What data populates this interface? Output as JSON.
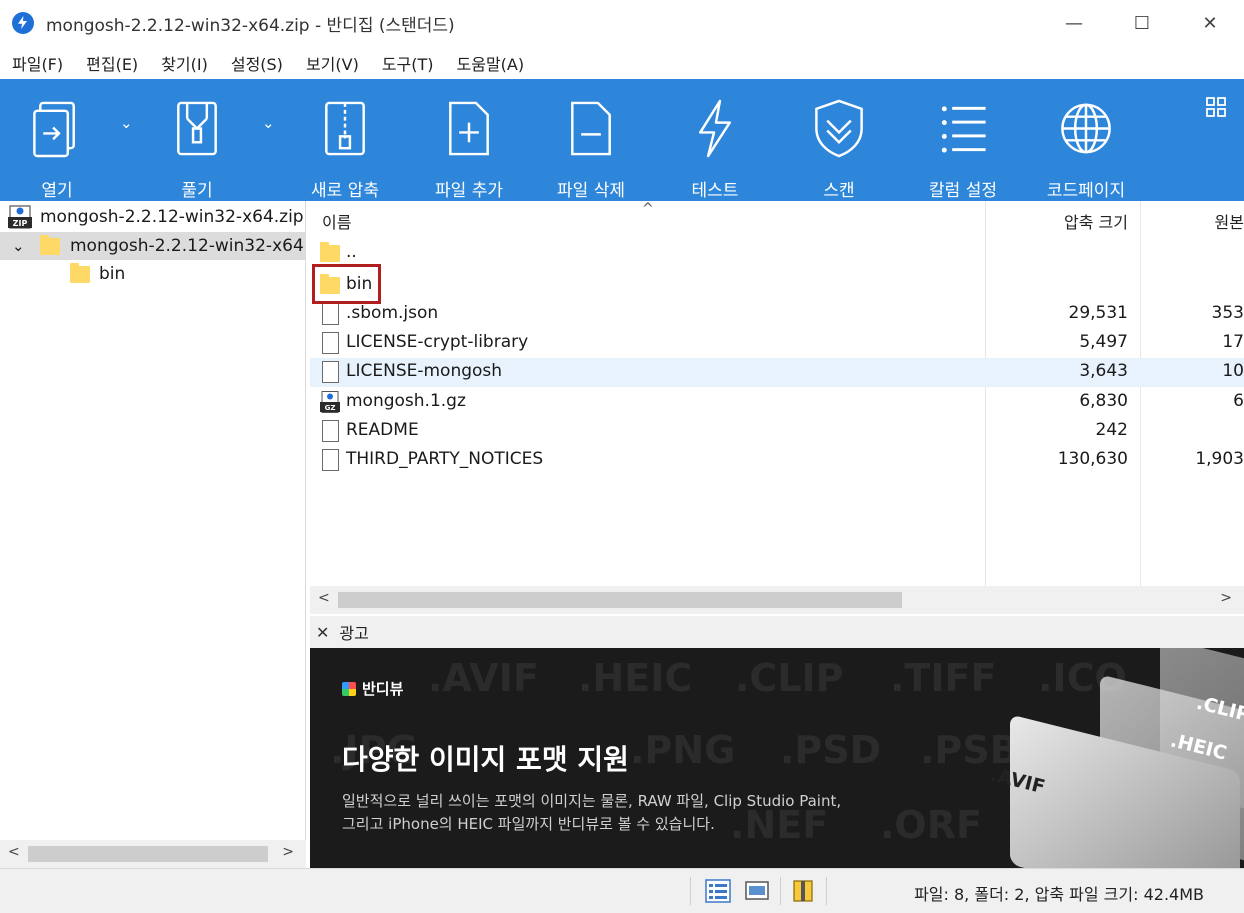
{
  "window": {
    "title": "mongosh-2.2.12-win32-x64.zip - 반디집 (스탠더드)",
    "min": "—",
    "max": "☐",
    "close": "✕"
  },
  "menu": [
    "파일(F)",
    "편집(E)",
    "찾기(I)",
    "설정(S)",
    "보기(V)",
    "도구(T)",
    "도움말(A)"
  ],
  "toolbar": {
    "open": "열기",
    "extract": "풀기",
    "new_archive": "새로 압축",
    "add_files": "파일 추가",
    "delete_files": "파일 삭제",
    "test": "테스트",
    "scan": "스캔",
    "column_settings": "칼럼 설정",
    "codepage": "코드페이지"
  },
  "tree": {
    "root": "mongosh-2.2.12-win32-x64.zip",
    "folder": "mongosh-2.2.12-win32-x64",
    "child": "bin",
    "expand_glyph": "⌄"
  },
  "columns": {
    "name": "이름",
    "compressed": "압축 크기",
    "original": "원본"
  },
  "files": [
    {
      "name": "..",
      "type": "folder",
      "compressed": "",
      "original": ""
    },
    {
      "name": "bin",
      "type": "folder",
      "compressed": "",
      "original": ""
    },
    {
      "name": ".sbom.json",
      "type": "file",
      "compressed": "29,531",
      "original": "353"
    },
    {
      "name": "LICENSE-crypt-library",
      "type": "file",
      "compressed": "5,497",
      "original": "17"
    },
    {
      "name": "LICENSE-mongosh",
      "type": "file",
      "compressed": "3,643",
      "original": "10"
    },
    {
      "name": "mongosh.1.gz",
      "type": "gz",
      "compressed": "6,830",
      "original": "6"
    },
    {
      "name": "README",
      "type": "file",
      "compressed": "242",
      "original": ""
    },
    {
      "name": "THIRD_PARTY_NOTICES",
      "type": "file",
      "compressed": "130,630",
      "original": "1,903"
    }
  ],
  "ad": {
    "close": "✕",
    "label": "광고",
    "brand": "반디뷰",
    "headline": "다양한 이미지 포맷 지원",
    "desc_line1": "일반적으로 널리 쓰이는 포맷의 이미지는 물론, RAW 파일, Clip Studio Paint,",
    "desc_line2": "그리고 iPhone의 HEIC 파일까지 반디뷰로 볼 수 있습니다.",
    "bg_words": [
      ".AVIF",
      ".HEIC",
      ".CLIP",
      ".TIFF",
      ".ICO",
      ".JPG",
      ".PNG",
      ".PSD",
      ".PSB",
      ".NEF",
      ".ORF"
    ],
    "cards": [
      ".CLIP",
      ".HEIC",
      ".AVIF"
    ]
  },
  "status": {
    "text": "파일: 8, 폴더: 2, 압축 파일 크기: 42.4MB"
  },
  "scroll": {
    "left": "<",
    "right": ">"
  },
  "colors": {
    "toolbar_bg": "#2d86d9",
    "highlight": "#b01e1e",
    "folder": "#ffd966"
  }
}
